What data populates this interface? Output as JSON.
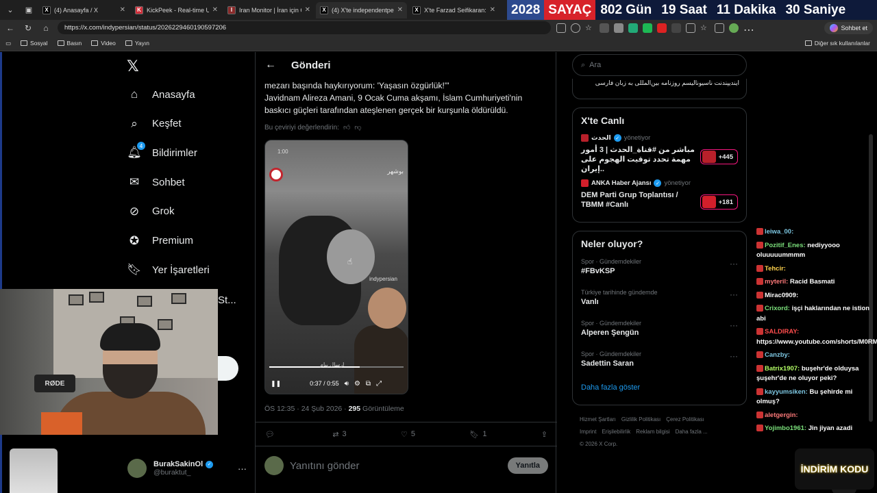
{
  "browser": {
    "tabs": [
      {
        "title": "(4) Anasayfa / X",
        "fav": "X",
        "fav_color": "#000000",
        "active": false
      },
      {
        "title": "KickPeek - Real-time URL Cl",
        "fav": "K",
        "fav_color": "#d12f3a",
        "active": false
      },
      {
        "title": "Iran Monitor | İran için Gerç",
        "fav": "I",
        "fav_color": "#8a2a2a",
        "active": false
      },
      {
        "title": "(4) X'te independentpe",
        "fav": "X",
        "fav_color": "#000000",
        "active": true
      },
      {
        "title": "X'te Farzad Seifikaran: \"If-T",
        "fav": "X",
        "fav_color": "#000000",
        "active": false
      }
    ],
    "url": "https://x.com/indypersian/status/2026229460190597206",
    "copilot_label": "Sohbet et",
    "bookmarks": [
      "Sosyal",
      "Basın",
      "Video",
      "Yayın"
    ],
    "bookmarks_right": "Diğer sık kullanılanlar"
  },
  "countdown": {
    "year": "2028",
    "label": "SAYAÇ",
    "segments": [
      "802 Gün",
      "19 Saat",
      "11 Dakika",
      "30 Saniye"
    ]
  },
  "nav": {
    "items": [
      {
        "label": "Anasayfa",
        "icon": "home-icon"
      },
      {
        "label": "Keşfet",
        "icon": "search-icon"
      },
      {
        "label": "Bildirimler",
        "icon": "bell-icon",
        "badge": "4"
      },
      {
        "label": "Sohbet",
        "icon": "mail-icon"
      },
      {
        "label": "Grok",
        "icon": "grok-icon"
      },
      {
        "label": "Premium",
        "icon": "premium-icon"
      },
      {
        "label": "Yer İşaretleri",
        "icon": "bookmark-icon"
      }
    ],
    "truncated_item": "St...",
    "profile": {
      "name": "BurakSakinOl",
      "handle": "@buraktut_"
    }
  },
  "post": {
    "header_title": "Gönderi",
    "text_lines": [
      "mezarı başında haykırıyorum: 'Yaşasın özgürlük!'\"",
      "Javidnam Alireza Amani, 9 Ocak Cuma akşamı, İslam Cumhuriyeti'nin",
      "baskıcı güçleri tarafından ateşlenen gerçek bir kurşunla öldürüldü."
    ],
    "rate_translation": "Bu çeviriyi değerlendirin:",
    "video": {
      "time": "0:37 / 0:55",
      "progress": 0.673,
      "location": "بوشهر",
      "timestamp_label": "1:00",
      "watermark": "indypersian",
      "caption": "ارسال پیام"
    },
    "timestamp": "ÖS 12:35 · 24 Şub 2026 ·",
    "views_count": "295",
    "views_label": "Görüntüleme",
    "actions": {
      "replies": "",
      "reposts": "3",
      "likes": "5",
      "bookmarks": "1"
    },
    "reply_placeholder": "Yanıtını gönder",
    "reply_button": "Yanıtla"
  },
  "sidebar": {
    "search_placeholder": "Ara",
    "top_snippet": "ایندیپندنت ناسیونالیسم روزنامه بین‌المللی به زبان فارسی",
    "live_title": "X'te Canlı",
    "live": [
      {
        "host": "الحدث",
        "role": "yönetiyor",
        "title": "مباشر من #قناة_الحدث | 3 أمور مهمة تحدد توقيت الهجوم على إيران..",
        "count": "+445",
        "color": "#b8202a"
      },
      {
        "host": "ANKA Haber Ajansı",
        "role": "yönetiyor",
        "title": "DEM Parti Grup Toplantısı / TBMM #Canlı",
        "count": "+181",
        "color": "#d21f2b"
      }
    ],
    "trends_title": "Neler oluyor?",
    "trends": [
      {
        "context": "Spor · Gündemdekiler",
        "name": "#FBvKSP"
      },
      {
        "context": "Türkiye tarihinde gündemde",
        "name": "Vanlı"
      },
      {
        "context": "Spor · Gündemdekiler",
        "name": "Alperen Şengün"
      },
      {
        "context": "Spor · Gündemdekiler",
        "name": "Sadettin Saran"
      }
    ],
    "show_more": "Daha fazla göster",
    "footer": [
      "Hizmet Şartları",
      "Gizlilik Politikası",
      "Çerez Politikası",
      "Imprint",
      "Erişilebilirlik",
      "Reklam bilgisi",
      "Daha fazla ...",
      "© 2026 X Corp."
    ]
  },
  "chat": [
    {
      "user": "leiwa_00:",
      "text": "",
      "color": "#7ec8e3"
    },
    {
      "user": "Pozitif_Enes:",
      "text": "nediyyooo oluuuuummmm",
      "color": "#7be07b"
    },
    {
      "user": "Tehcir:",
      "text": "",
      "color": "#ffd24d"
    },
    {
      "user": "myteril:",
      "text": "Racid Basmati",
      "color": "#ff7a7a"
    },
    {
      "user": "Mirac0909:",
      "text": "",
      "color": "#ffffff"
    },
    {
      "user": "Crixord:",
      "text": "işçi haklarından ne istion abi",
      "color": "#7be07b"
    },
    {
      "user": "SALDIRAY:",
      "text": "https://www.youtube.com/shorts/M0RM68_rBCw",
      "color": "#ff4d4d"
    },
    {
      "user": "Canzby:",
      "text": "",
      "color": "#7ec8e3"
    },
    {
      "user": "Batrix1907:",
      "text": "buşehr'de olduysa şuşehr'de ne oluyor peki?",
      "color": "#b4ff66"
    },
    {
      "user": "kayyumsiken:",
      "text": "Bu şehirde mi olmuş?",
      "color": "#7ec8e3"
    },
    {
      "user": "aletgergin:",
      "text": "",
      "color": "#ff7a7a"
    },
    {
      "user": "Yojimbo1961:",
      "text": "Jin jiyan azadi",
      "color": "#7be07b"
    }
  ],
  "overlay": {
    "webcam_mic_label": "RØDE",
    "promo": "İNDİRİM KODU"
  }
}
